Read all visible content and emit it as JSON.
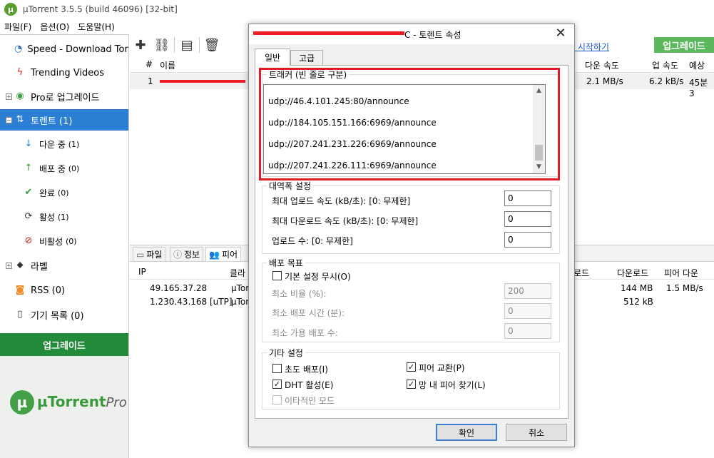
{
  "app": {
    "title": "µTorrent 3.5.5  (build 46096) [32-bit]"
  },
  "menu": [
    "파일(F)",
    "옵션(O)",
    "도움말(H)"
  ],
  "sidebar": {
    "items": [
      {
        "label": "Speed - Download Torre",
        "icon": "speedometer-icon"
      },
      {
        "label": "Trending Videos",
        "icon": "lightning-icon"
      },
      {
        "label": "Pro로 업그레이드",
        "icon": "pro-icon"
      },
      {
        "label": "토렌트 (1)",
        "icon": "torrent-icon"
      },
      {
        "label": "다운 중",
        "count": "(1)",
        "icon": "down-arrow-icon"
      },
      {
        "label": "배포 중",
        "count": "(0)",
        "icon": "up-arrow-icon"
      },
      {
        "label": "완료",
        "count": "(0)",
        "icon": "check-icon"
      },
      {
        "label": "활성",
        "count": "(1)",
        "icon": "refresh-icon"
      },
      {
        "label": "비활성",
        "count": "(0)",
        "icon": "inactive-icon"
      },
      {
        "label": "라벨",
        "icon": "tag-icon"
      },
      {
        "label": "RSS (0)",
        "icon": "rss-icon"
      },
      {
        "label": "기기 목록 (0)",
        "icon": "device-icon"
      }
    ],
    "upgrade_label": "업그레이드",
    "logo_text": "µTorrent",
    "logo_pro": "Pro"
  },
  "toolbar": {
    "upgrade_label": "업그레이드",
    "start_link": "사 시작하기"
  },
  "list": {
    "headers": {
      "num": "#",
      "name": "이름",
      "down_speed": "다운 속도",
      "up_speed": "업 속도",
      "eta": "예상 시"
    },
    "rows": [
      {
        "num": "1",
        "down_speed": "2.1 MB/s",
        "up_speed": "6.2 kB/s",
        "eta": "45분 3"
      }
    ]
  },
  "details": {
    "tabs": [
      "파일",
      "정보",
      "피어"
    ],
    "peer_headers": {
      "ip": "IP",
      "client": "클라",
      "download_col": "로드",
      "downloaded": "다운로드",
      "peer_down": "피어 다운"
    },
    "peers": [
      {
        "ip": "49.165.37.28",
        "client": "µTor",
        "downloaded": "144 MB",
        "peer_down": "1.5 MB/s"
      },
      {
        "ip": "1.230.43.168 [uTP]",
        "client": "µTor",
        "downloaded": "512 kB",
        "peer_down": ""
      }
    ]
  },
  "dialog": {
    "title_suffix": "C - 토렌트 속성",
    "tabs": [
      "일반",
      "고급"
    ],
    "tracker": {
      "legend": "트래커 (빈 줄로 구분)",
      "lines": [
        "udp://46.4.101.245:80/announce",
        "udp://184.105.151.166:6969/announce",
        "udp://207.241.231.226:6969/announce",
        "udp://207.241.226.111:6969/announce"
      ]
    },
    "bandwidth": {
      "legend": "대역폭 설정",
      "max_upload_label": "최대 업로드 속도 (kB/초): [0: 무제한]",
      "max_upload_value": "0",
      "max_download_label": "최대 다운로드 속도 (kB/초): [0: 무제한]",
      "max_download_value": "0",
      "upload_slots_label": "업로드 수: [0: 무제한]",
      "upload_slots_value": "0"
    },
    "seeding": {
      "legend": "배포 목표",
      "override_label": "기본 설정 무시(O)",
      "min_ratio_label": "최소 비율 (%):",
      "min_ratio_value": "200",
      "min_time_label": "최소 배포 시간 (분):",
      "min_time_value": "0",
      "min_seeds_label": "최소 가용 배포 수:",
      "min_seeds_value": "0"
    },
    "other": {
      "legend": "기타 설정",
      "initial_seeding": "초도 배포(I)",
      "peer_exchange": "피어 교환(P)",
      "dht": "DHT 활성(E)",
      "local_peer": "망 내 피어 찾기(L)",
      "exclusive": "이타적인 모드"
    },
    "ok": "확인",
    "cancel": "취소"
  },
  "colors": {
    "selected": "#2b7fd4",
    "upgrade_green": "#228b3a",
    "highlight_red": "#e11b23"
  }
}
